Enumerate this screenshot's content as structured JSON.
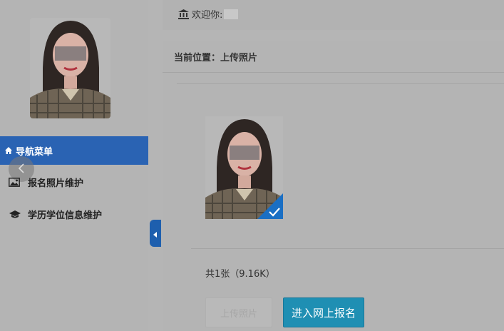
{
  "topbar": {
    "welcome_label": "欢迎你:"
  },
  "breadcrumb": {
    "label": "当前位置：",
    "current": "上传照片"
  },
  "sidebar": {
    "nav_header": "导航菜单",
    "items": [
      {
        "label": "报名照片维护",
        "icon": "image-icon"
      },
      {
        "label": "学历学位信息维护",
        "icon": "graduation-cap-icon"
      }
    ]
  },
  "main": {
    "photo_count": "共1张（9.16K）",
    "upload_button": "上传照片",
    "enter_button": "进入网上报名"
  },
  "colors": {
    "nav_active": "#2a63b3",
    "enter_button": "#1f8fb3",
    "check_badge": "#1a6fc4"
  }
}
